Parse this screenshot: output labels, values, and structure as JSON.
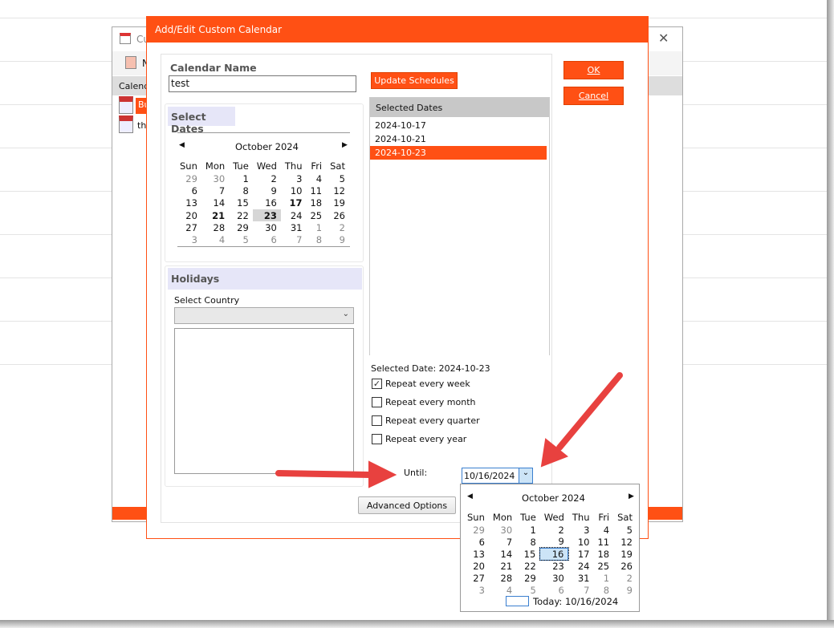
{
  "background_window": {
    "title": "Cu",
    "toolbar_item": "N",
    "column_header": "Calend",
    "items": [
      {
        "label": "Bu",
        "selected": true
      },
      {
        "label": "th",
        "selected": false
      }
    ]
  },
  "dialog": {
    "title": "Add/Edit Custom Calendar",
    "accent": "#FF5014",
    "calendar_name_label": "Calendar Name",
    "calendar_name_value": "test",
    "ok_label": "OK",
    "cancel_label": "Cancel",
    "update_schedules_label": "Update Schedules",
    "select_dates": {
      "header": "Select Dates",
      "month": "October 2024",
      "weekdays": [
        "Sun",
        "Mon",
        "Tue",
        "Wed",
        "Thu",
        "Fri",
        "Sat"
      ],
      "weeks": [
        [
          29,
          30,
          1,
          2,
          3,
          4,
          5
        ],
        [
          6,
          7,
          8,
          9,
          10,
          11,
          12
        ],
        [
          13,
          14,
          15,
          16,
          17,
          18,
          19
        ],
        [
          20,
          21,
          22,
          23,
          24,
          25,
          26
        ],
        [
          27,
          28,
          29,
          30,
          31,
          1,
          2
        ],
        [
          3,
          4,
          5,
          6,
          7,
          8,
          9
        ]
      ],
      "bold_dates": [
        17,
        21,
        23
      ],
      "selected_date": 23
    },
    "holidays": {
      "header": "Holidays",
      "select_country_label": "Select Country",
      "country_value": ""
    },
    "selected_dates": {
      "header": "Selected Dates",
      "items": [
        "2024-10-17",
        "2024-10-21",
        "2024-10-23"
      ],
      "selected_index": 2
    },
    "selected_date_text": "Selected Date: 2024-10-23",
    "repeat_options": [
      {
        "label": "Repeat every week",
        "checked": true
      },
      {
        "label": "Repeat every month",
        "checked": false
      },
      {
        "label": "Repeat every quarter",
        "checked": false
      },
      {
        "label": "Repeat every year",
        "checked": false
      }
    ],
    "until_label": "Until:",
    "until_value": "10/16/2024",
    "advanced_options_label": "Advanced Options",
    "popup_calendar": {
      "month": "October 2024",
      "weekdays": [
        "Sun",
        "Mon",
        "Tue",
        "Wed",
        "Thu",
        "Fri",
        "Sat"
      ],
      "weeks": [
        [
          29,
          30,
          1,
          2,
          3,
          4,
          5
        ],
        [
          6,
          7,
          8,
          9,
          10,
          11,
          12
        ],
        [
          13,
          14,
          15,
          16,
          17,
          18,
          19
        ],
        [
          20,
          21,
          22,
          23,
          24,
          25,
          26
        ],
        [
          27,
          28,
          29,
          30,
          31,
          1,
          2
        ],
        [
          3,
          4,
          5,
          6,
          7,
          8,
          9
        ]
      ],
      "selected_date": 16,
      "today_text": "Today: 10/16/2024"
    }
  },
  "annotation_color": "#E8413F"
}
